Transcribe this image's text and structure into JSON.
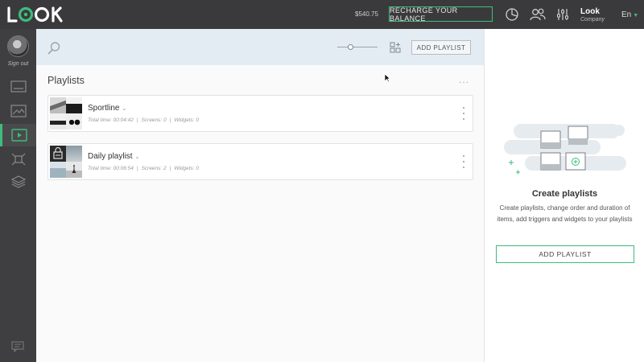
{
  "topbar": {
    "logo_text": "LOOK",
    "balance": "$540.75",
    "recharge_label": "RECHARGE YOUR BALANCE",
    "user_name": "Look",
    "user_company": "Company",
    "language": "En"
  },
  "sidebar": {
    "signout_label": "Sign out",
    "items": [
      {
        "name": "screens",
        "icon": "screen-icon"
      },
      {
        "name": "media",
        "icon": "image-icon"
      },
      {
        "name": "playlists",
        "icon": "playlist-icon",
        "active": true
      },
      {
        "name": "widgets",
        "icon": "widgets-icon"
      },
      {
        "name": "layers",
        "icon": "layers-icon"
      }
    ]
  },
  "toolbar": {
    "add_playlist_label": "ADD PLAYLIST",
    "zoom_level": 0.3
  },
  "main": {
    "title": "Playlists",
    "more_label": "...",
    "playlists": [
      {
        "name": "Sportline",
        "total_time": "Total time: 00:04:42",
        "screens": "Screens: 0",
        "widgets": "Widgets: 0"
      },
      {
        "name": "Daily playlist",
        "total_time": "Total time: 00:06:54",
        "screens": "Screens: 2",
        "widgets": "Widgets: 0"
      }
    ]
  },
  "right_panel": {
    "title": "Create playlists",
    "description": "Create playlists, change order and duration of items, add triggers and widgets to your playlists",
    "button_label": "ADD PLAYLIST"
  },
  "colors": {
    "accent": "#3dbd7d",
    "topbar_bg": "#3a3a3c",
    "sidebar_bg": "#3f3f41",
    "toolbar_bg": "#e4ecf3"
  }
}
